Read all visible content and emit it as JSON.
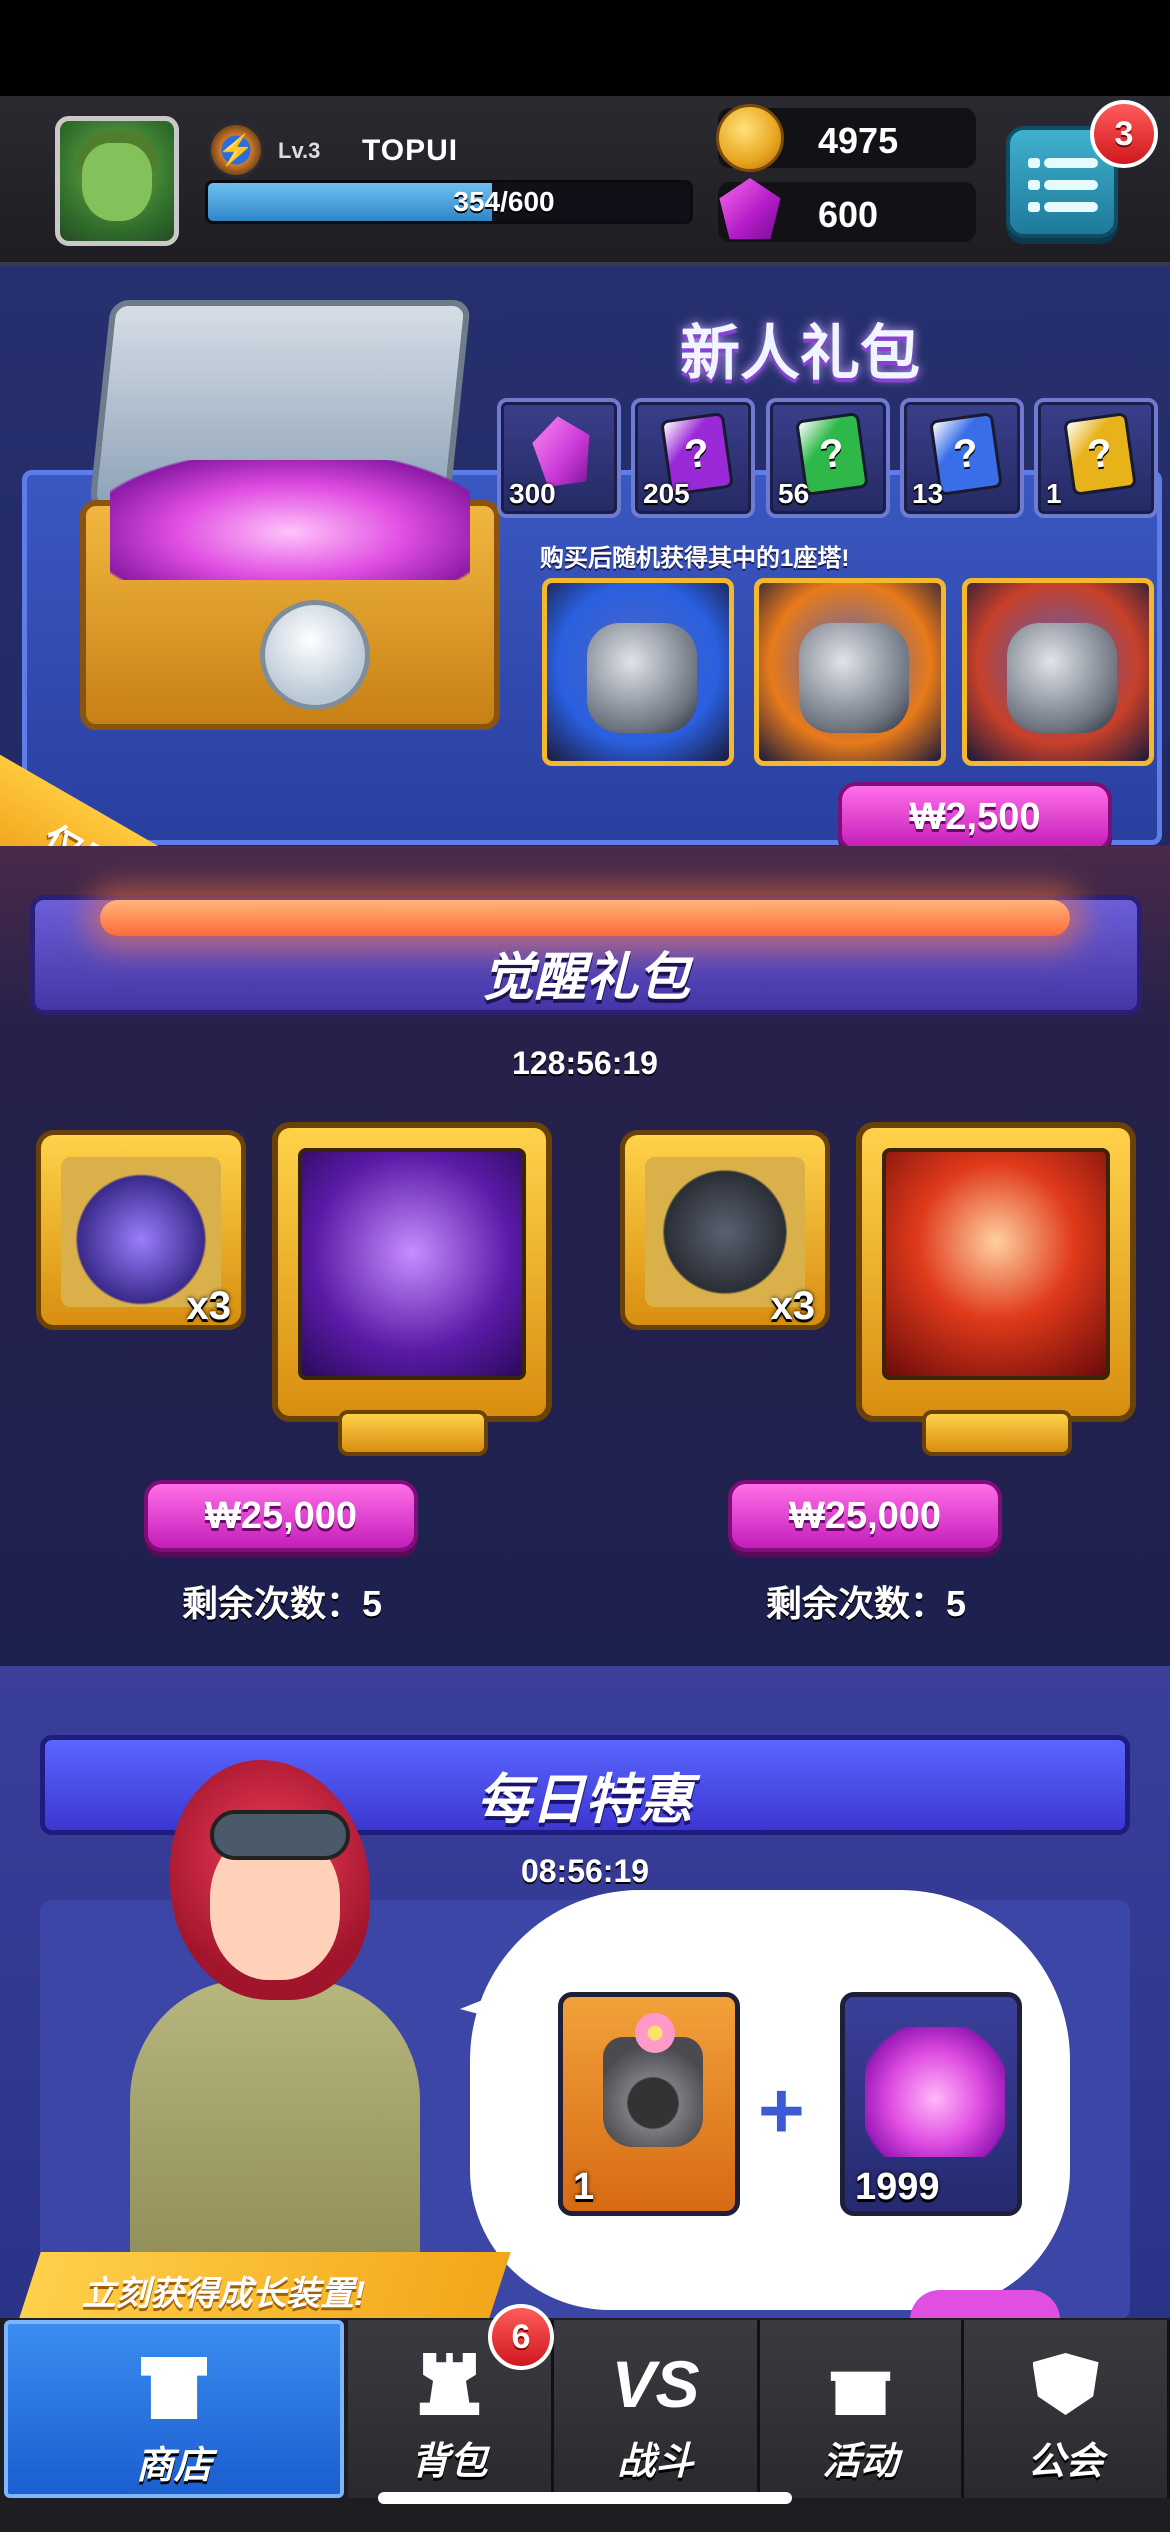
{
  "header": {
    "level": "Lv.3",
    "username": "TOPUI",
    "xp_text": "354/600",
    "xp_fraction": 0.59,
    "gold": "4975",
    "gems": "600",
    "menu_badge": "3"
  },
  "newbie_pack": {
    "title": "新人礼包",
    "ribbon": "仅限一次",
    "items": [
      {
        "icon": "gem-pile-icon",
        "count": "300",
        "color": "#c93ad8"
      },
      {
        "icon": "purple-card-icon",
        "count": "205",
        "color": "#9a2ad8",
        "glyph": "?"
      },
      {
        "icon": "green-card-icon",
        "count": "56",
        "color": "#2fb84a",
        "glyph": "?"
      },
      {
        "icon": "blue-card-icon",
        "count": "13",
        "color": "#3a6ee8",
        "glyph": "?"
      },
      {
        "icon": "gold-card-icon",
        "count": "1",
        "color": "#e8b21a",
        "glyph": "?"
      }
    ],
    "note": "购买后随机获得其中的1座塔!",
    "towers": [
      {
        "icon": "drill-tower-icon",
        "bg": "#2a5fe0"
      },
      {
        "icon": "cannon-tower-icon",
        "bg": "#e87a1a"
      },
      {
        "icon": "rocket-tower-icon",
        "bg": "#c8402a"
      }
    ],
    "price": "₩2,500"
  },
  "awaken_pack": {
    "title": "觉醒礼包",
    "timer": "128:56:19",
    "offers": [
      {
        "small_icon": "orb-tower-icon",
        "multiplier": "x3",
        "big_icon": "dna-icon",
        "price": "₩25,000",
        "remaining": "剩余次数：5"
      },
      {
        "small_icon": "telescope-tower-icon",
        "multiplier": "x3",
        "big_icon": "laser-blast-icon",
        "price": "₩25,000",
        "remaining": "剩余次数：5"
      }
    ]
  },
  "daily_deal": {
    "title": "每日特惠",
    "timer": "08:56:19",
    "rewards": [
      {
        "icon": "flower-cannon-icon",
        "count": "1"
      },
      {
        "icon": "gem-pile-icon",
        "count": "1999"
      }
    ],
    "plus": "+",
    "cta": "立刻获得成长装置!"
  },
  "tabs": [
    {
      "label": "商店",
      "icon": "shop-icon",
      "active": true
    },
    {
      "label": "背包",
      "icon": "rook-icon",
      "badge": "6"
    },
    {
      "label": "战斗",
      "icon": "vs-icon",
      "icon_text": "VS"
    },
    {
      "label": "活动",
      "icon": "gift-icon"
    },
    {
      "label": "公会",
      "icon": "guild-shield-icon"
    }
  ]
}
